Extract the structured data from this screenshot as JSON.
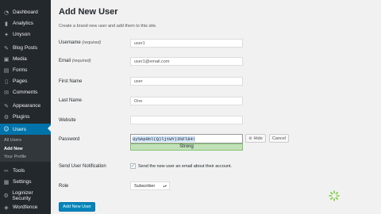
{
  "sidebar": {
    "items": [
      {
        "label": "Dashboard",
        "icon": "dashboard-icon",
        "glyph": "◔"
      },
      {
        "label": "Analytics",
        "icon": "analytics-icon",
        "glyph": "▮"
      },
      {
        "label": "Unyson",
        "icon": "unyson-icon",
        "glyph": "✦"
      },
      {
        "label": "Blog Posts",
        "icon": "pin-icon",
        "glyph": "✎"
      },
      {
        "label": "Media",
        "icon": "media-icon",
        "glyph": "▣"
      },
      {
        "label": "Forms",
        "icon": "forms-icon",
        "glyph": "▤"
      },
      {
        "label": "Pages",
        "icon": "pages-icon",
        "glyph": "▯"
      },
      {
        "label": "Comments",
        "icon": "comments-icon",
        "glyph": "✉"
      },
      {
        "label": "Appearance",
        "icon": "appearance-icon",
        "glyph": "✎"
      },
      {
        "label": "Plugins",
        "icon": "plugins-icon",
        "glyph": "⚙"
      },
      {
        "label": "Users",
        "icon": "users-icon",
        "glyph": "☺"
      },
      {
        "label": "Tools",
        "icon": "tools-icon",
        "glyph": "✂"
      },
      {
        "label": "Settings",
        "icon": "settings-icon",
        "glyph": "▦"
      },
      {
        "label": "Loginizer Security",
        "icon": "loginizer-icon",
        "glyph": "⚙"
      },
      {
        "label": "Wordfence",
        "icon": "wordfence-icon",
        "glyph": "◈"
      }
    ],
    "submenu": [
      "All Users",
      "Add New",
      "Your Profile"
    ]
  },
  "page": {
    "title": "Add New User",
    "description": "Create a brand new user and add them to this site."
  },
  "form": {
    "username_label": "Username",
    "username_required": "(required)",
    "username_value": "user1",
    "email_label": "Email",
    "email_required": "(required)",
    "email_value": "user1@email.com",
    "first_name_label": "First Name",
    "first_name_value": "user",
    "last_name_label": "Last Name",
    "last_name_value": "One",
    "website_label": "Website",
    "website_value": "",
    "password_label": "Password",
    "password_value": "Uy%Ap9bl(Q)ljtWY)3%Fl84!",
    "hide_label": "Hide",
    "cancel_label": "Cancel",
    "strength_label": "Strong",
    "notify_label": "Send User Notification",
    "notify_text": "Send the new user an email about their account.",
    "role_label": "Role",
    "role_value": "Subscriber",
    "submit_label": "Add New User"
  },
  "colors": {
    "sidebar": "#23282d",
    "accent": "#0073aa",
    "strength": "#c1e1b9",
    "spinner": "#7ad03a"
  }
}
